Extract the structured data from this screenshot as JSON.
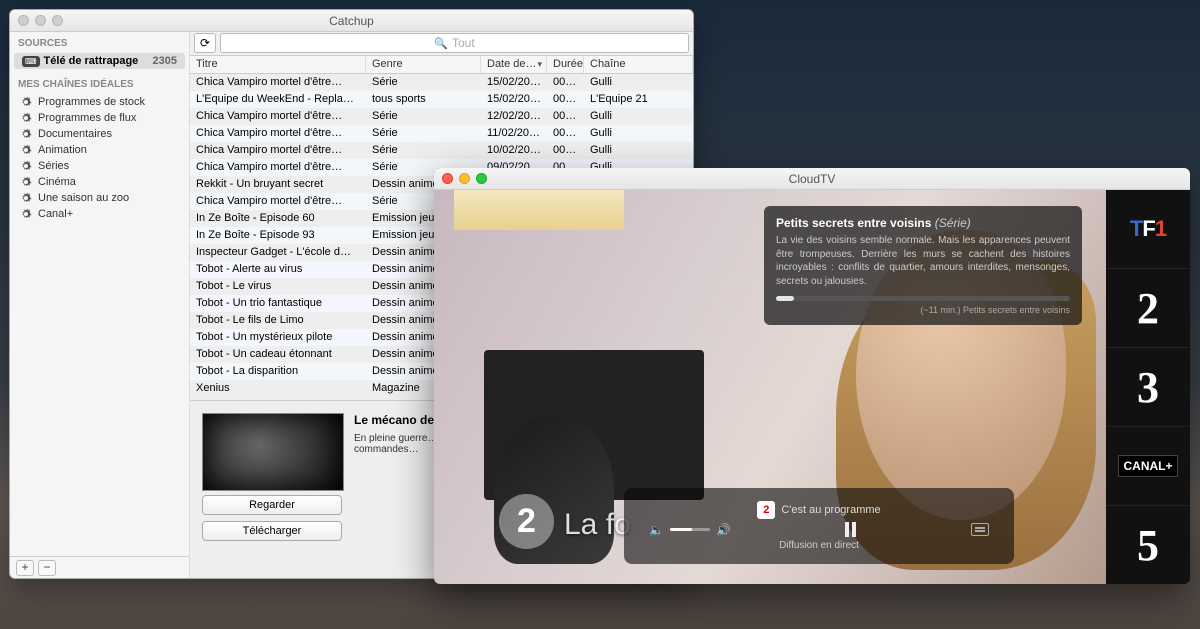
{
  "catchup": {
    "title": "Catchup",
    "source": {
      "section": "SOURCES",
      "name": "Télé de rattrapage",
      "count": "2305"
    },
    "ideal_section": "MES CHAÎNES IDÉALES",
    "ideal_items": [
      "Programmes de stock",
      "Programmes de flux",
      "Documentaires",
      "Animation",
      "Séries",
      "Cinéma",
      "Une saison au zoo",
      "Canal+"
    ],
    "search_placeholder": "Tout",
    "columns": {
      "titre": "Titre",
      "genre": "Genre",
      "date": "Date de…",
      "duree": "Durée",
      "chaine": "Chaîne"
    },
    "rows": [
      {
        "t": "Chica Vampiro mortel d'être…",
        "g": "Série",
        "d": "15/02/20…",
        "u": "00:…",
        "c": "Gulli"
      },
      {
        "t": "L'Equipe du WeekEnd - Repla…",
        "g": "tous sports",
        "d": "15/02/20…",
        "u": "00:…",
        "c": "L'Equipe 21"
      },
      {
        "t": "Chica Vampiro mortel d'être…",
        "g": "Série",
        "d": "12/02/20…",
        "u": "00:…",
        "c": "Gulli"
      },
      {
        "t": "Chica Vampiro mortel d'être…",
        "g": "Série",
        "d": "11/02/20…",
        "u": "00:…",
        "c": "Gulli"
      },
      {
        "t": "Chica Vampiro mortel d'être…",
        "g": "Série",
        "d": "10/02/20…",
        "u": "00:…",
        "c": "Gulli"
      },
      {
        "t": "Chica Vampiro mortel d'être…",
        "g": "Série",
        "d": "09/02/20…",
        "u": "00:…",
        "c": "Gulli"
      },
      {
        "t": "Rekkit - Un bruyant secret",
        "g": "Dessin anime…",
        "d": "",
        "u": "",
        "c": ""
      },
      {
        "t": "Chica Vampiro mortel d'être…",
        "g": "Série",
        "d": "",
        "u": "",
        "c": ""
      },
      {
        "t": "In Ze Boîte - Episode 60",
        "g": "Emission jeu…",
        "d": "",
        "u": "",
        "c": ""
      },
      {
        "t": "In Ze Boîte - Episode 93",
        "g": "Emission jeu…",
        "d": "",
        "u": "",
        "c": ""
      },
      {
        "t": "Inspecteur Gadget - L'école d…",
        "g": "Dessin anime…",
        "d": "",
        "u": "",
        "c": ""
      },
      {
        "t": "Tobot - Alerte au virus",
        "g": "Dessin anime…",
        "d": "",
        "u": "",
        "c": ""
      },
      {
        "t": "Tobot - Le virus",
        "g": "Dessin anime…",
        "d": "",
        "u": "",
        "c": ""
      },
      {
        "t": "Tobot - Un trio fantastique",
        "g": "Dessin anime…",
        "d": "",
        "u": "",
        "c": ""
      },
      {
        "t": "Tobot - Le fils de Limo",
        "g": "Dessin anime…",
        "d": "",
        "u": "",
        "c": ""
      },
      {
        "t": "Tobot - Un mystérieux pilote",
        "g": "Dessin anime…",
        "d": "",
        "u": "",
        "c": ""
      },
      {
        "t": "Tobot - Un cadeau étonnant",
        "g": "Dessin anime…",
        "d": "",
        "u": "",
        "c": ""
      },
      {
        "t": "Tobot - La disparition",
        "g": "Dessin anime…",
        "d": "",
        "u": "",
        "c": ""
      },
      {
        "t": "Xenius",
        "g": "Magazine",
        "d": "",
        "u": "",
        "c": ""
      }
    ],
    "detail": {
      "title": "Le mécano de",
      "desc": "En pleine guerre… des nordistes q… chef-d'oeuvre d… aux commandes…",
      "watch": "Regarder",
      "download": "Télécharger"
    },
    "add": "+",
    "remove": "−",
    "reload": "⟳"
  },
  "cloud": {
    "title": "CloudTV",
    "program": {
      "name": "Petits secrets entre voisins",
      "kind": "(Série)"
    },
    "desc": "La vie des voisins semble normale. Mais les apparences peuvent être trompeuses. Derrière les murs se cachent des histoires incroyables : conflits de quartier, amours interdites, mensonges, secrets ou jalousies.",
    "remaining": "(~11 min.) Petits secrets entre voisins",
    "now": {
      "ch": "2",
      "label": "C'est au programme"
    },
    "live": "Diffusion en direct",
    "bottom_overlay": "La fo",
    "channels": [
      "TF1",
      "2",
      "3",
      "CANAL+",
      "5"
    ],
    "vol_low": "🔈",
    "vol_high": "🔊"
  }
}
